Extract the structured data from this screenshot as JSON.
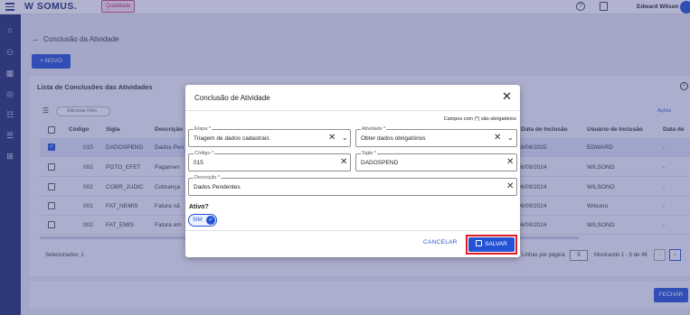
{
  "header": {
    "logo_text": "W SOMUS.",
    "quality_badge": "Qualidade",
    "user_name": "Edward Wilson"
  },
  "page": {
    "title": "Conclusão da Atividade",
    "new_button": "+ NOVO",
    "list_title": "Lista de Conclusões das Atividades",
    "filter_chip": "Adicionar Filtro",
    "actions_label": "Ações",
    "close_button": "FECHAR"
  },
  "table": {
    "columns": [
      "Código",
      "Sigla",
      "Descrição",
      "Data de Inclusão",
      "Usuário de Inclusão",
      "Data de"
    ],
    "rows": [
      {
        "selected": true,
        "code": "015",
        "sigla": "DADOSPEND",
        "desc": "Dados Pen",
        "date": "16/06/2025",
        "user": "EDWARD",
        "last": "-"
      },
      {
        "selected": false,
        "code": "002",
        "sigla": "PGTO_EFET",
        "desc": "Pagamen",
        "date": "06/09/2024",
        "user": "WILSONO",
        "last": "-"
      },
      {
        "selected": false,
        "code": "002",
        "sigla": "COBR_JUDIC",
        "desc": "Cobrança",
        "date": "06/09/2024",
        "user": "WILSONO",
        "last": "-"
      },
      {
        "selected": false,
        "code": "001",
        "sigla": "FAT_NEMIS",
        "desc": "Fatura nã",
        "date": "06/09/2024",
        "user": "Wilsono",
        "last": "-"
      },
      {
        "selected": false,
        "code": "002",
        "sigla": "FAT_EMIS",
        "desc": "Fatura em",
        "date": "06/09/2024",
        "user": "WILSONO",
        "last": "-"
      }
    ]
  },
  "footer": {
    "selected_count": "Selecionados: 1",
    "rows_per_page_label": "Linhas por página",
    "rows_per_page": "5",
    "range": "Mostrando 1 - 5 de 48"
  },
  "modal": {
    "title": "Conclusão de Atividade",
    "required_note": "Campos com (*) são obrigatórios",
    "fields": {
      "etapa": {
        "label": "Etapa *",
        "value": "Triagem de dados cadastrais"
      },
      "atividade": {
        "label": "Atividade *",
        "value": "Obter dados obrigatórios"
      },
      "codigo": {
        "label": "Código *",
        "value": "015"
      },
      "sigla": {
        "label": "Sigla *",
        "value": "DADOSPEND"
      },
      "descricao": {
        "label": "Descrição *",
        "value": "Dados Pendentes"
      }
    },
    "active_label": "Ativo?",
    "active_value": "SIM",
    "cancel_button": "CANCELAR",
    "save_button": "SALVAR"
  },
  "colors": {
    "primary": "#2452d2",
    "sidebar": "#1f2d6b",
    "highlight": "#e01b24"
  }
}
